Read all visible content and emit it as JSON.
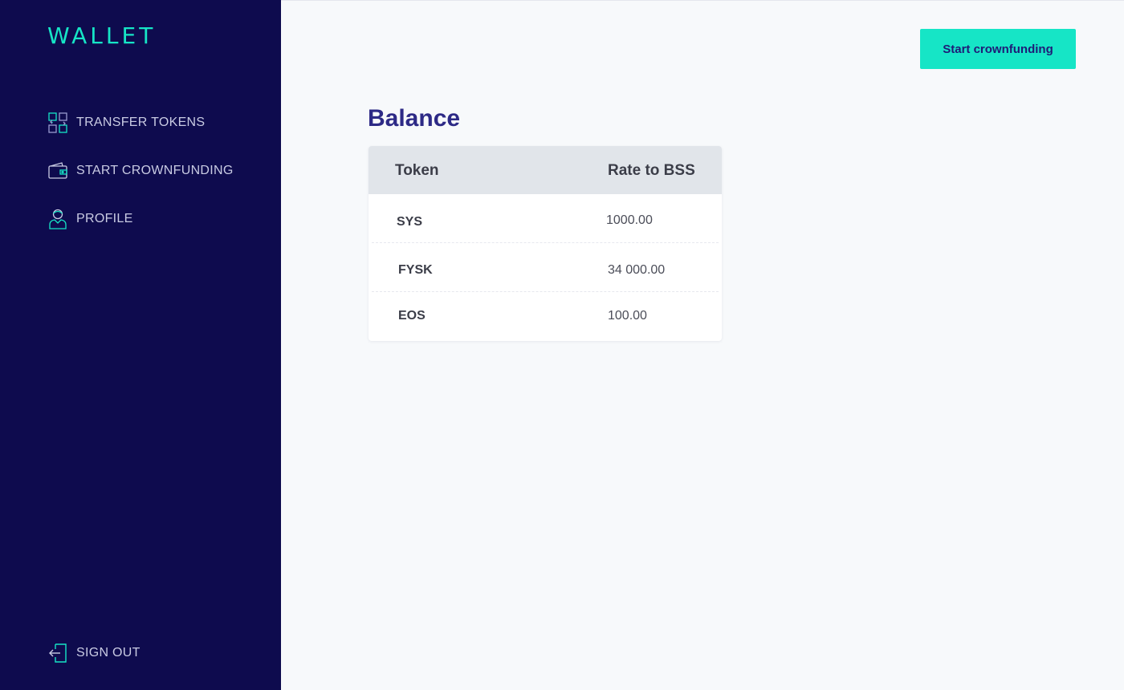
{
  "sidebar": {
    "logo": "WALLET",
    "items": [
      {
        "label": "TRANSFER TOKENS",
        "icon": "transfer-icon"
      },
      {
        "label": "START CROWNFUNDING",
        "icon": "wallet-icon"
      },
      {
        "label": "PROFILE",
        "icon": "user-icon"
      }
    ],
    "sign_out": {
      "label": "SIGN OUT",
      "icon": "sign-out-icon"
    }
  },
  "header": {
    "cta_label": "Start crownfunding"
  },
  "main": {
    "title": "Balance",
    "table": {
      "columns": [
        "Token",
        "Rate to BSS"
      ],
      "rows": [
        {
          "token": "SYS",
          "rate": "1000.00"
        },
        {
          "token": "FYSK",
          "rate": "34 000.00"
        },
        {
          "token": "EOS",
          "rate": "100.00"
        }
      ]
    }
  },
  "colors": {
    "sidebar_bg": "#0e0b4e",
    "accent": "#16e5c6",
    "title": "#2d2a86",
    "table_header_bg": "#e1e5ea"
  }
}
